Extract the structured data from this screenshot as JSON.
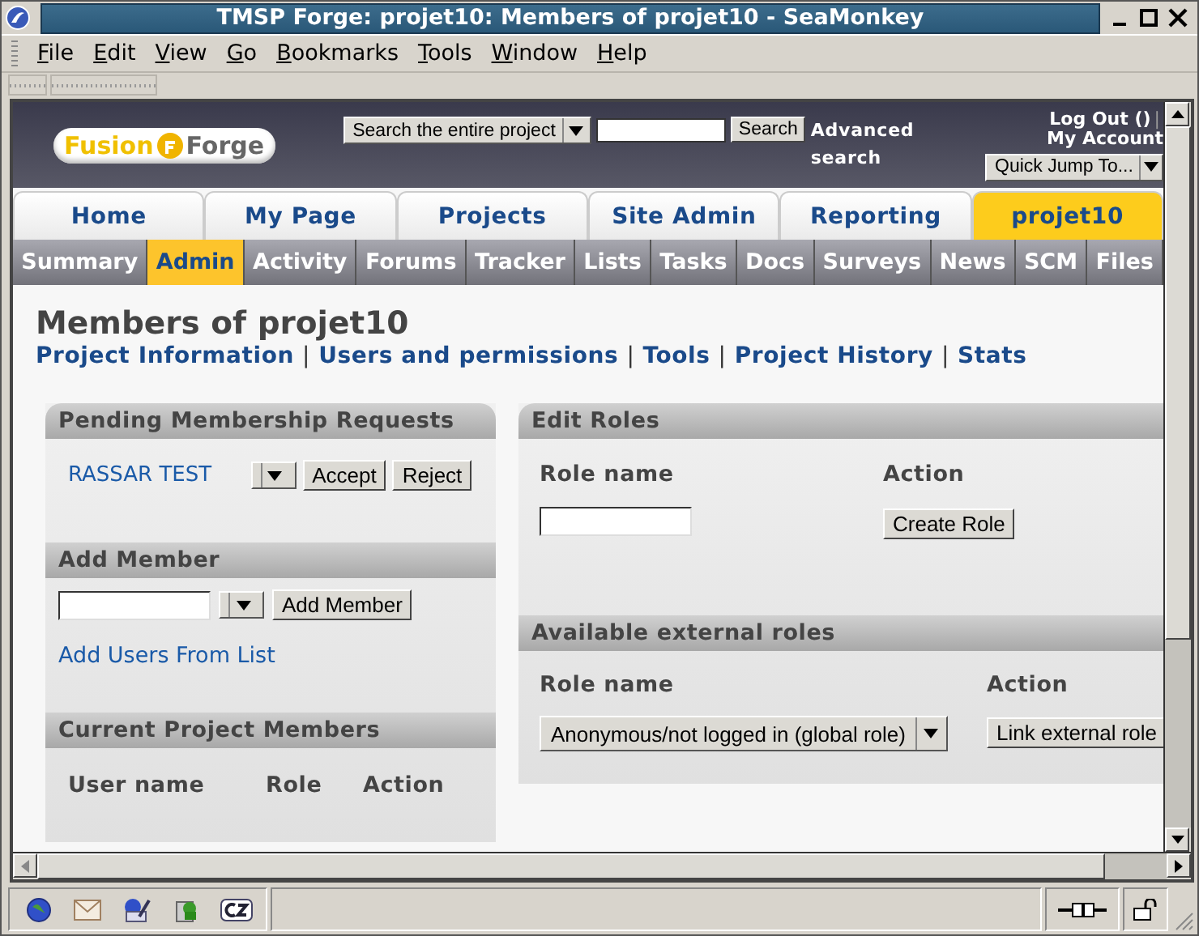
{
  "window": {
    "title": "TMSP Forge: projet10: Members of projet10 - SeaMonkey"
  },
  "menu": [
    "File",
    "Edit",
    "View",
    "Go",
    "Bookmarks",
    "Tools",
    "Window",
    "Help"
  ],
  "header": {
    "logo": {
      "first": "Fusion",
      "second": "Forge"
    },
    "search_scope": "Search the entire project",
    "search_button": "Search",
    "advanced": "Advanced search",
    "logout": "Log Out ()",
    "separator": "|",
    "account": "My Account",
    "quick_jump": "Quick Jump To..."
  },
  "tabs": [
    {
      "label": "Home",
      "selected": false
    },
    {
      "label": "My Page",
      "selected": false
    },
    {
      "label": "Projects",
      "selected": false
    },
    {
      "label": "Site Admin",
      "selected": false
    },
    {
      "label": "Reporting",
      "selected": false
    },
    {
      "label": "projet10",
      "selected": true
    }
  ],
  "subtabs": [
    {
      "label": "Summary",
      "selected": false
    },
    {
      "label": "Admin",
      "selected": true
    },
    {
      "label": "Activity",
      "selected": false
    },
    {
      "label": "Forums",
      "selected": false
    },
    {
      "label": "Tracker",
      "selected": false
    },
    {
      "label": "Lists",
      "selected": false
    },
    {
      "label": "Tasks",
      "selected": false
    },
    {
      "label": "Docs",
      "selected": false
    },
    {
      "label": "Surveys",
      "selected": false
    },
    {
      "label": "News",
      "selected": false
    },
    {
      "label": "SCM",
      "selected": false
    },
    {
      "label": "Files",
      "selected": false
    }
  ],
  "page": {
    "title": "Members of projet10",
    "links": [
      "Project Information",
      "Users and permissions",
      "Tools",
      "Project History",
      "Stats"
    ],
    "separator": "|"
  },
  "pending": {
    "title": "Pending Membership Requests",
    "requests": [
      {
        "name": "RASSAR TEST",
        "accept": "Accept",
        "reject": "Reject"
      }
    ]
  },
  "add_member": {
    "title": "Add Member",
    "button": "Add Member",
    "list_link": "Add Users From List"
  },
  "current_members": {
    "title": "Current Project Members",
    "columns": [
      "User name",
      "Role",
      "Action"
    ]
  },
  "edit_roles": {
    "title": "Edit Roles",
    "columns": [
      "Role name",
      "Action"
    ],
    "button": "Create Role"
  },
  "external_roles": {
    "title": "Available external roles",
    "columns": [
      "Role name",
      "Action"
    ],
    "selected_role": "Anonymous/not logged in (global role)",
    "button": "Link external role"
  }
}
